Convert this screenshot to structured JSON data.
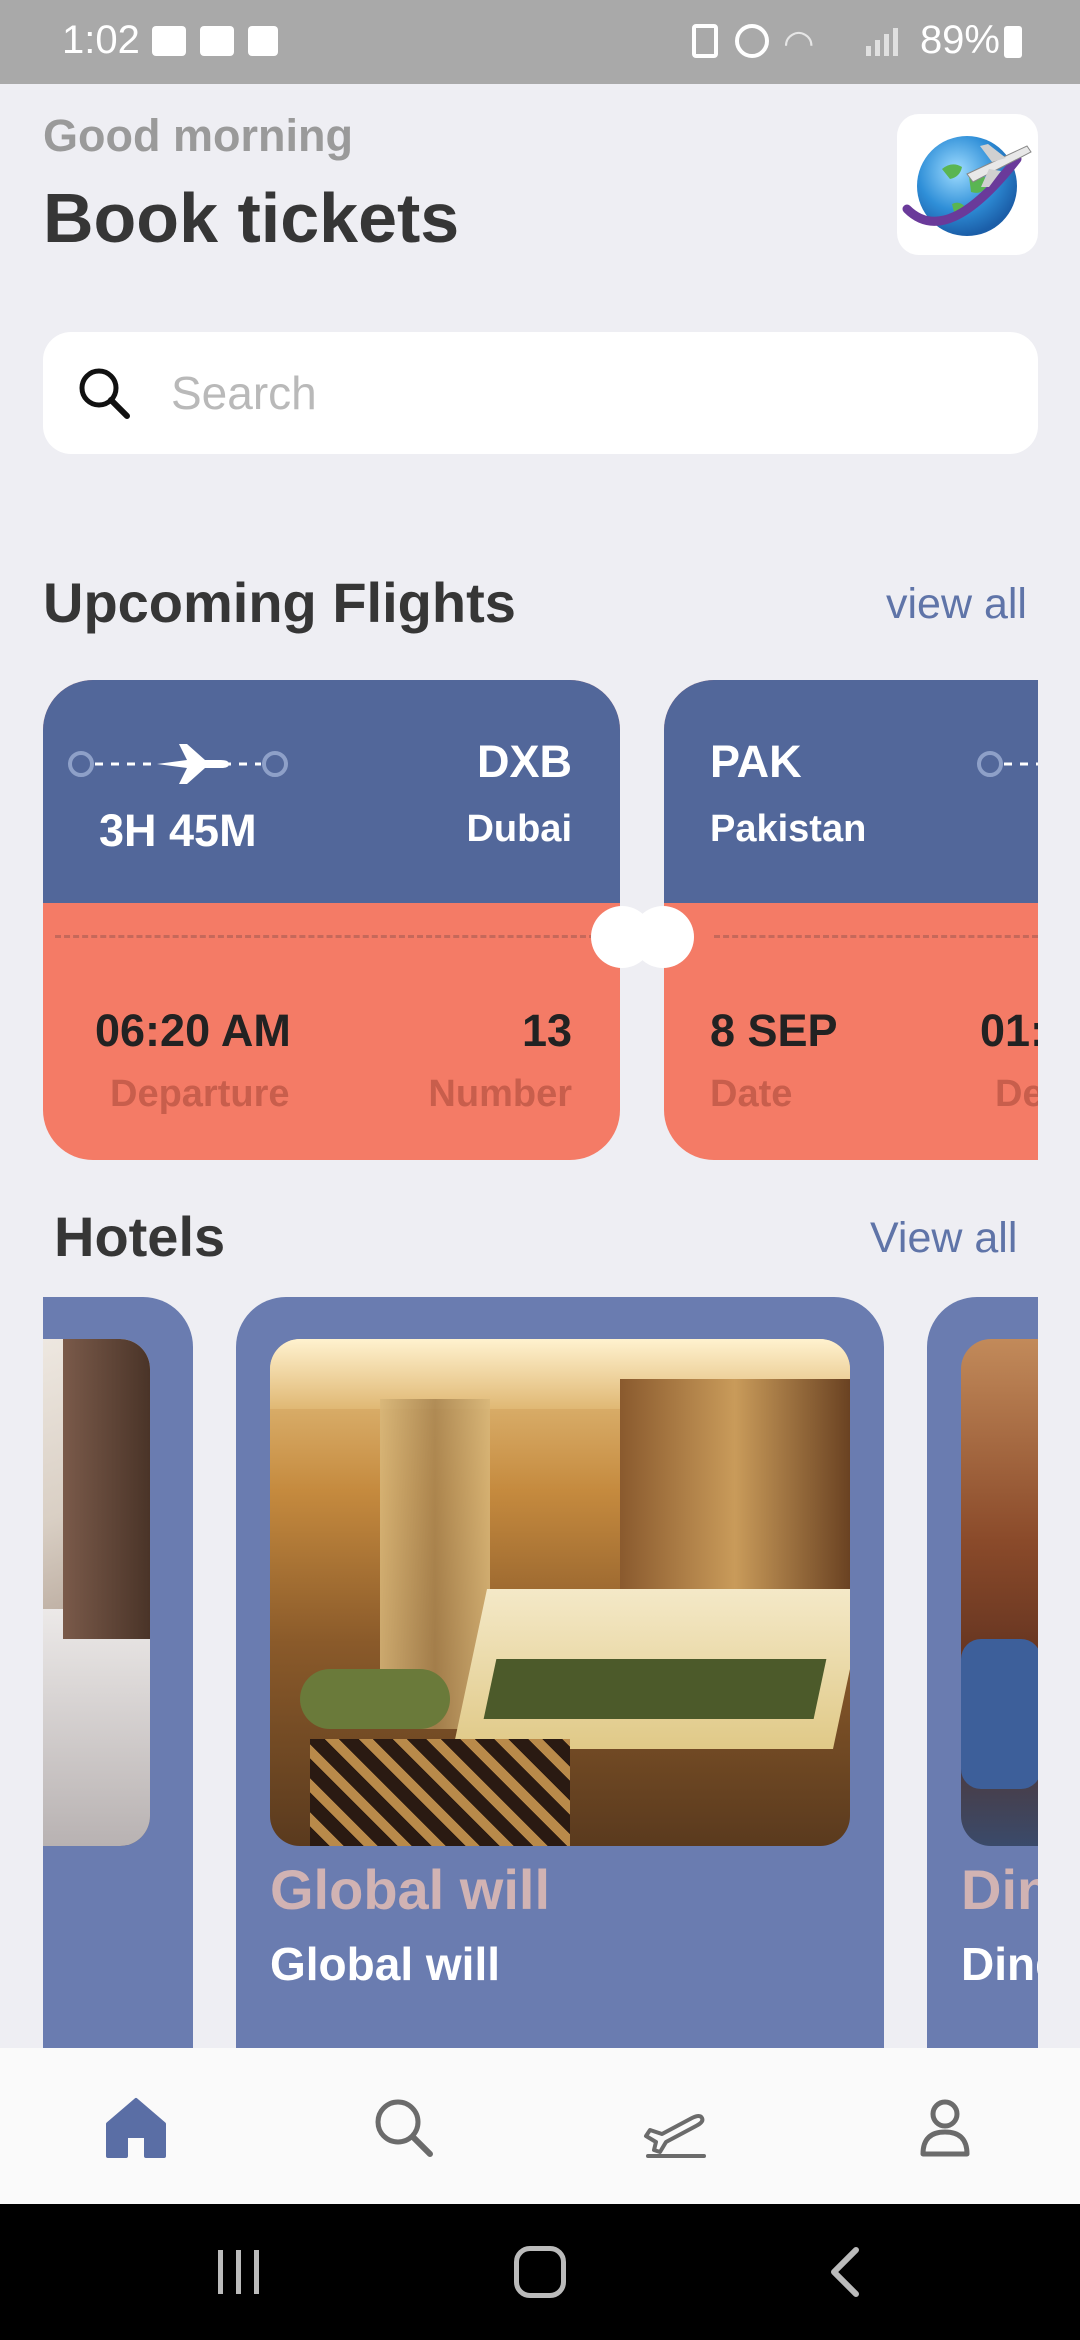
{
  "status_bar": {
    "time": "1:02",
    "battery": "89%"
  },
  "header": {
    "greeting": "Good morning",
    "title": "Book tickets",
    "logo_icon": "globe-plane-logo"
  },
  "search": {
    "placeholder": "Search"
  },
  "flights_section": {
    "title": "Upcoming Flights",
    "view_all": "view all",
    "cards": [
      {
        "duration": "3H 45M",
        "code": "DXB",
        "city": "Dubai",
        "time": "06:20 AM",
        "time_label": "Departure",
        "number": "13",
        "number_label": "Number"
      },
      {
        "code": "PAK",
        "city": "Pakistan",
        "date": "8 SEP",
        "date_label": "Date",
        "time_partial": "01:",
        "time_label_partial": "De"
      }
    ]
  },
  "hotels_section": {
    "title": "Hotels",
    "view_all": "View all",
    "cards": [
      {
        "name": "Global will",
        "subtitle": "Global will"
      },
      {
        "name_partial": "Din",
        "subtitle_partial": "Ding"
      }
    ]
  },
  "bottom_nav": {
    "items": [
      "home-icon",
      "search-icon",
      "flight-icon",
      "profile-icon"
    ],
    "active_color": "#5a6ea5",
    "inactive_color": "#6b6b6b"
  },
  "colors": {
    "flight_top": "#52679a",
    "flight_bottom": "#f47b66",
    "hotel_card": "#6a7cb0"
  }
}
